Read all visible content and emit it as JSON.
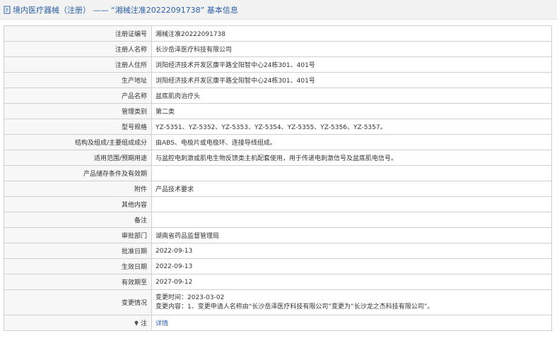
{
  "header": {
    "breadcrumb_prefix": "境内医疗器械（注册）",
    "separator": "——",
    "record_title": "“湘械注准20222091738”",
    "suffix": "基本信息",
    "icon": "document-icon"
  },
  "rows": [
    {
      "label": "注册证编号",
      "value": "湘械注准20222091738"
    },
    {
      "label": "注册人名称",
      "value": "长沙岳泽医疗科技有限公司"
    },
    {
      "label": "注册人住所",
      "value": "浏阳经济技术开发区康平路全阳智中心24栋301、401号"
    },
    {
      "label": "生产地址",
      "value": "浏阳经济技术开发区康平路全阳智中心24栋301、401号"
    },
    {
      "label": "产品名称",
      "value": "盆底肌肉治疗头"
    },
    {
      "label": "管理类别",
      "value": "第二类"
    },
    {
      "label": "型号规格",
      "value": "YZ-5351、YZ-5352、YZ-5353、YZ-5354、YZ-5355、YZ-5356、YZ-5357。"
    },
    {
      "label": "结构及组成/主要组成成分",
      "value": "由ABS、电极片或电极环、连接导线组成。"
    },
    {
      "label": "适用范围/预期用途",
      "value": "与盆腔电刺激或肌电生物反馈类主机配套使用，用于传递电刺激信号及盆底肌电信号。"
    },
    {
      "label": "产品储存条件及有效期",
      "value": ""
    },
    {
      "label": "附件",
      "value": "产品技术要求"
    },
    {
      "label": "其他内容",
      "value": ""
    },
    {
      "label": "备注",
      "value": ""
    },
    {
      "label": "审批部门",
      "value": "湖南省药品监督管理局"
    },
    {
      "label": "批准日期",
      "value": "2022-09-13"
    },
    {
      "label": "生效日期",
      "value": "2022-09-13"
    },
    {
      "label": "有效期至",
      "value": "2027-09-12"
    }
  ],
  "change": {
    "label": "变更情况",
    "line1": "变更时间：2023-03-02",
    "line2": "变更内容：1、变更申请人名称由“长沙岳泽医疗科技有限公司”变更为“长沙龙之杰科技有限公司”。"
  },
  "note": {
    "label": "注",
    "icon": "pin-icon",
    "link": "详情"
  },
  "colors": {
    "link": "#2a5fa8",
    "label_bg": "#f7f7f7",
    "border": "#cfcfcf",
    "titlebar_bg": "#f2f2f2"
  }
}
